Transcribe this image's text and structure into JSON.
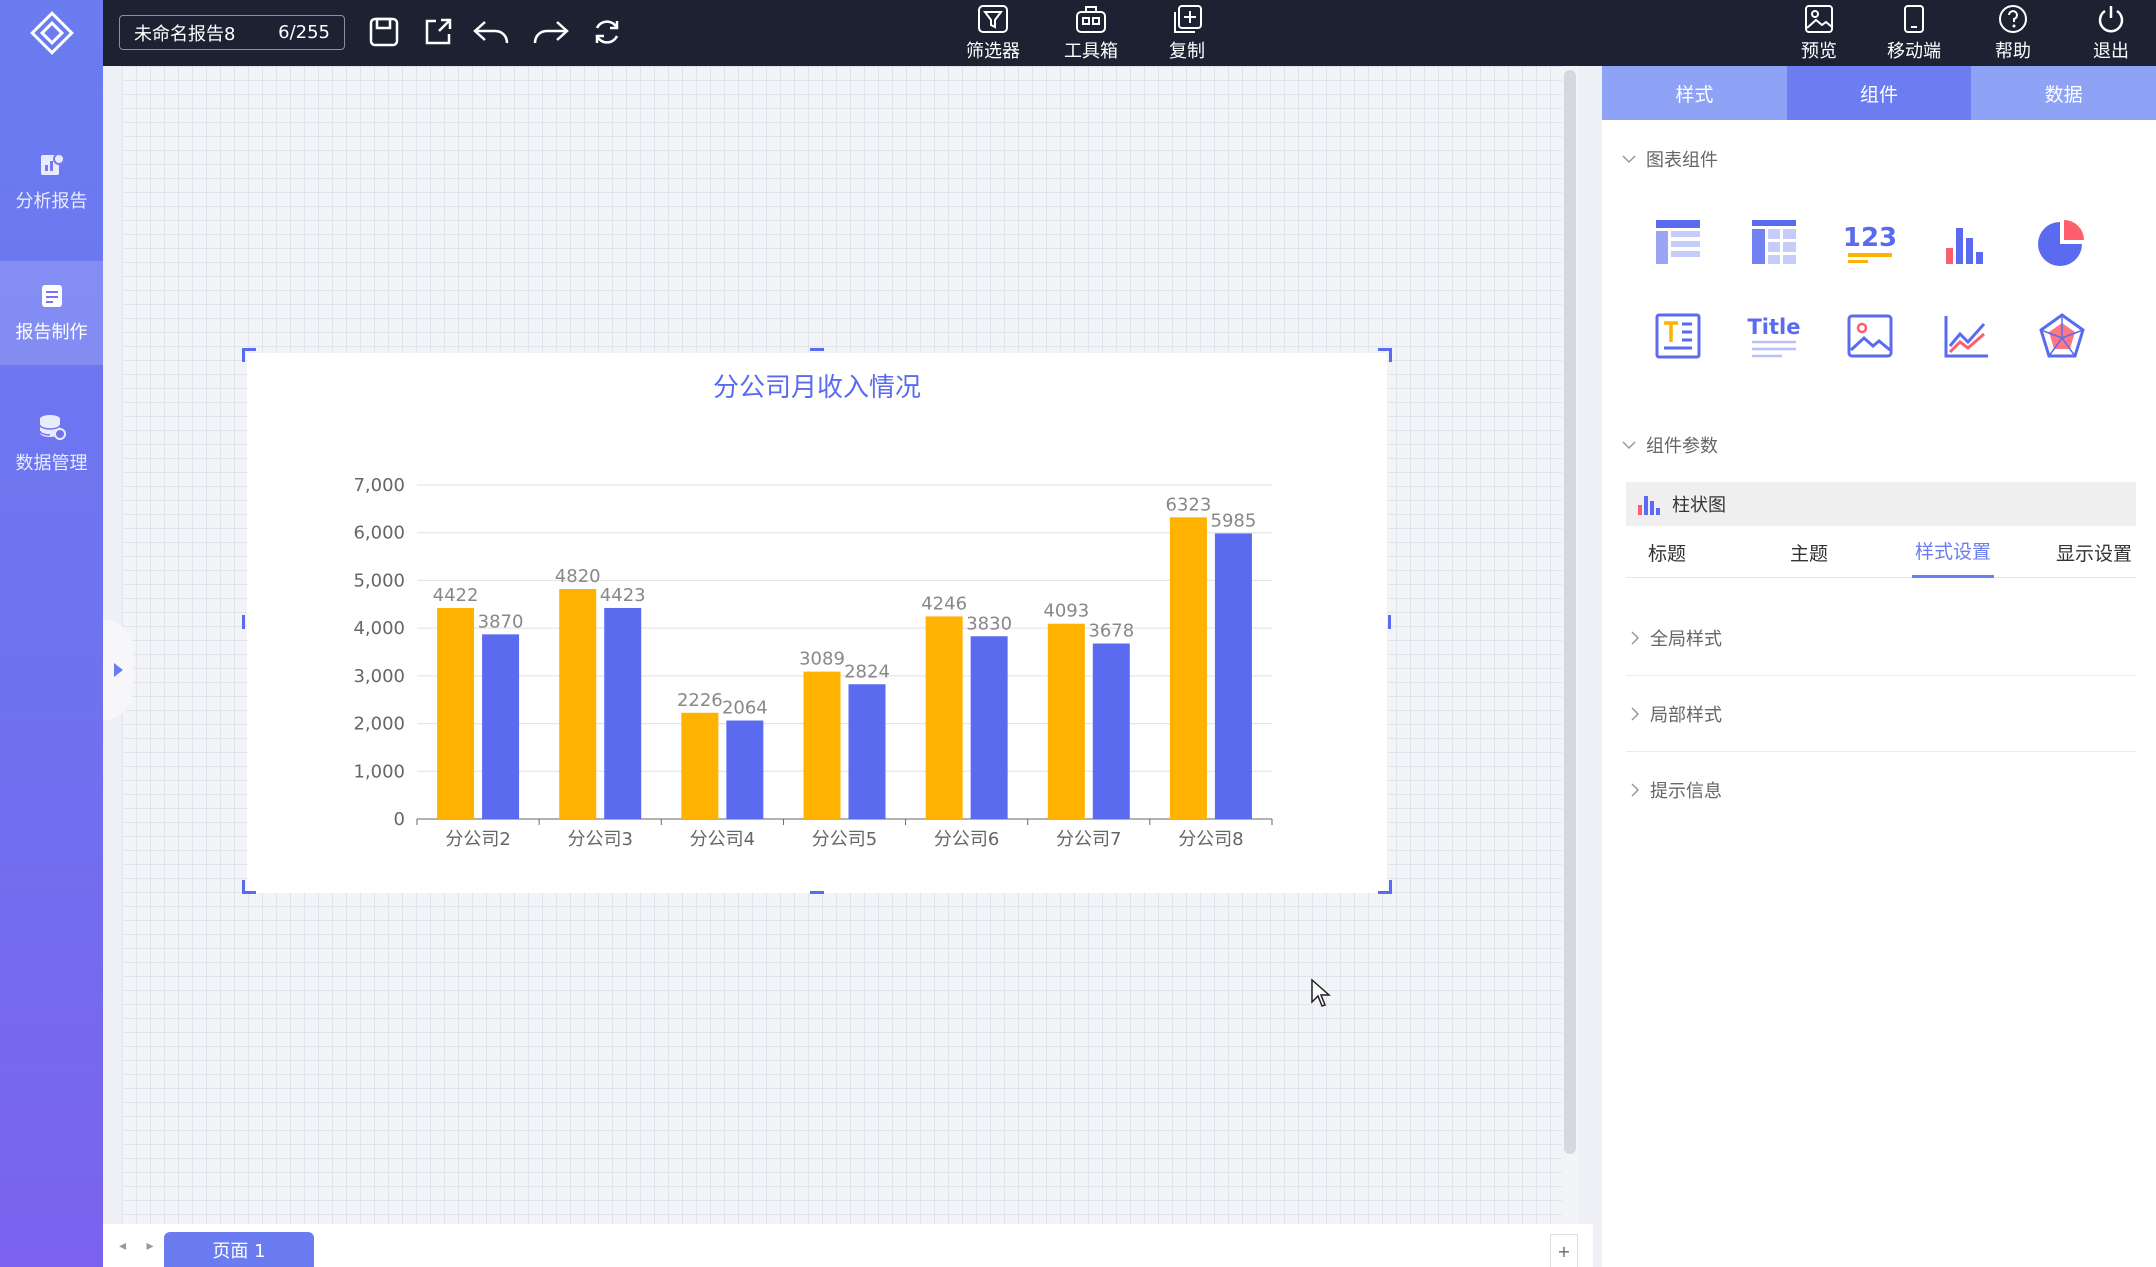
{
  "leftnav": {
    "items": [
      {
        "label": "分析报告",
        "icon": "report-analysis-icon"
      },
      {
        "label": "报告制作",
        "icon": "report-edit-icon",
        "active": true
      },
      {
        "label": "数据管理",
        "icon": "database-gear-icon"
      }
    ]
  },
  "toolbar": {
    "report_name": "未命名报告8",
    "report_count": "6/255",
    "buttons": [
      {
        "label": "筛选器",
        "icon": "filter-icon"
      },
      {
        "label": "工具箱",
        "icon": "toolbox-icon"
      },
      {
        "label": "复制",
        "icon": "copy-icon"
      }
    ],
    "right_buttons": [
      {
        "label": "预览",
        "icon": "preview-image-icon"
      },
      {
        "label": "移动端",
        "icon": "mobile-icon"
      },
      {
        "label": "帮助",
        "icon": "help-icon"
      },
      {
        "label": "退出",
        "icon": "power-icon"
      }
    ]
  },
  "chart_data": {
    "type": "bar",
    "title": "分公司月收入情况",
    "categories": [
      "分公司2",
      "分公司3",
      "分公司4",
      "分公司5",
      "分公司6",
      "分公司7",
      "分公司8"
    ],
    "series": [
      {
        "values": [
          4422,
          4820,
          2226,
          3089,
          4246,
          4093,
          6323
        ],
        "color": "#ffb200"
      },
      {
        "values": [
          3870,
          4423,
          2064,
          2824,
          3830,
          3678,
          5985
        ],
        "color": "#5b6bef"
      }
    ],
    "yticks": [
      "0",
      "1,000",
      "2,000",
      "3,000",
      "4,000",
      "5,000",
      "6,000",
      "7,000"
    ],
    "ylim": [
      0,
      7000
    ],
    "grid": true,
    "legend": "none"
  },
  "pagebar": {
    "arrows": "◂ ▸",
    "page_tab": "页面 1",
    "add": "+"
  },
  "right_panel": {
    "tabs": [
      "样式",
      "组件",
      "数据"
    ],
    "active_tab": "组件",
    "section_chart_components": "图表组件",
    "components": [
      {
        "icon": "table-icon"
      },
      {
        "icon": "crosstab-icon"
      },
      {
        "icon": "number-card-icon",
        "text": "123"
      },
      {
        "icon": "bar-chart-icon"
      },
      {
        "icon": "pie-chart-icon"
      },
      {
        "icon": "text-box-icon"
      },
      {
        "icon": "title-icon",
        "text": "Title"
      },
      {
        "icon": "image-icon"
      },
      {
        "icon": "line-chart-icon"
      },
      {
        "icon": "radar-chart-icon"
      }
    ],
    "section_params": "组件参数",
    "selected_component": "柱状图",
    "subtabs": [
      "标题",
      "主题",
      "样式设置",
      "显示设置"
    ],
    "active_subtab": "样式设置",
    "collapse_items": [
      "全局样式",
      "局部样式",
      "提示信息"
    ]
  },
  "colors": {
    "accent": "#6c7df1",
    "bar_orange": "#ffb200",
    "bar_blue": "#5b6bef",
    "topbar": "#1d2233"
  }
}
